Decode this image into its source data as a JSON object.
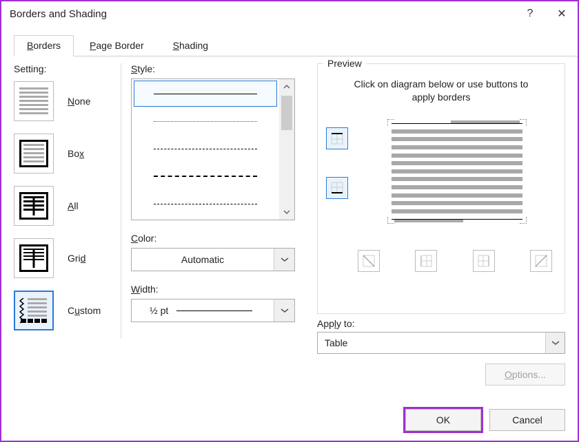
{
  "window": {
    "title": "Borders and Shading",
    "help_char": "?",
    "close_char": "✕"
  },
  "tabs": {
    "borders_b": "B",
    "borders_rest": "orders",
    "page_p": "P",
    "page_rest": "age Border",
    "shading_s": "S",
    "shading_rest": "hading"
  },
  "settings": {
    "label": "Setting:",
    "none_n": "N",
    "none_rest": "one",
    "box": "Bo",
    "box_x": "x",
    "all_a": "A",
    "all_rest": "ll",
    "grid": "Gri",
    "grid_d": "d",
    "custom": "C",
    "custom_u": "u",
    "custom_rest": "stom"
  },
  "style": {
    "label_s": "S",
    "label_rest": "tyle:",
    "color_c": "C",
    "color_rest": "olor:",
    "color_value": "Automatic",
    "width_w": "W",
    "width_rest": "idth:",
    "width_value": "½ pt"
  },
  "preview": {
    "legend": "Preview",
    "hint": "Click on diagram below or use buttons to apply borders",
    "apply_label": "App",
    "apply_l": "l",
    "apply_rest": "y to:",
    "apply_value": "Table",
    "options_o": "O",
    "options_rest": "ptions..."
  },
  "footer": {
    "ok": "OK",
    "cancel": "Cancel"
  }
}
